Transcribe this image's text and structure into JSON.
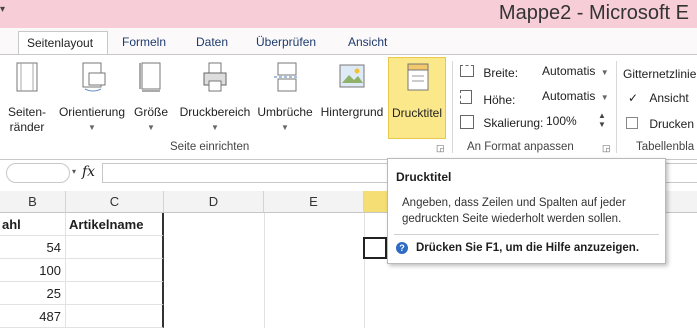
{
  "titlebar": {
    "title": "Mappe2 - Microsoft E",
    "quick_access": "▾"
  },
  "tabs": [
    "Seitenlayout",
    "Formeln",
    "Daten",
    "Überprüfen",
    "Ansicht"
  ],
  "ribbon": {
    "seiten_raender": [
      "Seiten-",
      "ränder"
    ],
    "orientierung": "Orientierung",
    "groesse": "Größe",
    "druckbereich": "Druckbereich",
    "umbrueche": "Umbrüche",
    "hintergrund": "Hintergrund",
    "drucktitel": "Drucktitel",
    "group_seite": "Seite einrichten",
    "breite_label": "Breite:",
    "breite_value": "Automatis",
    "hoehe_label": "Höhe:",
    "hoehe_value": "Automatis",
    "skalierung_label": "Skalierung:",
    "skalierung_value": "100%",
    "group_format": "An Format anpassen",
    "gitternetz_label": "Gitternetzlinie",
    "ansicht_label": "Ansicht",
    "drucken_label": "Drucken",
    "group_tabelle": "Tabellenbla"
  },
  "formula": {
    "fx": "fx"
  },
  "grid": {
    "columns": [
      "B",
      "C",
      "D",
      "E"
    ],
    "header_b": "ahl",
    "header_c": "Artikelname",
    "values": [
      "54",
      "100",
      "25",
      "487"
    ]
  },
  "tooltip": {
    "title": "Drucktitel",
    "body_line1": "Angeben, dass Zeilen und Spalten auf jeder",
    "body_line2": "gedruckten Seite wiederholt werden sollen.",
    "help": "Drücken Sie F1, um die Hilfe anzuzeigen."
  },
  "colors": {
    "titlebar": "#f7cdd8",
    "highlight": "#fbe88a",
    "tab_text": "#1e3b6e"
  }
}
